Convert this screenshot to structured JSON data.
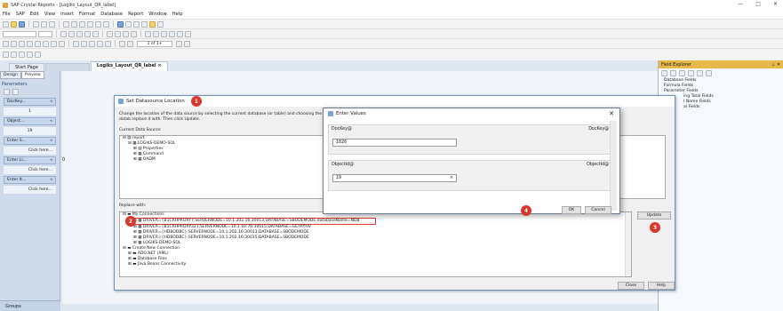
{
  "window": {
    "title": "SAP Crystal Reports - [Logiks_Layout_QR_label]",
    "controls": [
      "—",
      "□",
      "✕"
    ]
  },
  "menu": [
    "File",
    "SAP",
    "Edit",
    "View",
    "Insert",
    "Format",
    "Database",
    "Report",
    "Window",
    "Help"
  ],
  "toolbar": {
    "page_indicator": "1 of 1+"
  },
  "tabs": [
    "Start Page",
    "Logiks_Layout_QR_label"
  ],
  "left_panel": {
    "tabs": [
      "Design",
      "Preview"
    ],
    "title": "Parameters",
    "items": [
      {
        "label": "DocKey...",
        "value": "1"
      },
      {
        "label": "Object...",
        "value": "19"
      },
      {
        "label": "Enter S...",
        "value": "Click here..."
      },
      {
        "label": "Enter Li...",
        "value": "Click here..."
      },
      {
        "label": "Enter It...",
        "value": "Click here..."
      }
    ],
    "canvas_value": "0",
    "groups": "Groups"
  },
  "field_explorer": {
    "title": "Field Explorer",
    "items": [
      "Database Fields",
      "Formula Fields",
      "Parameter Fields",
      "ing Total Fields",
      "l Name Fields",
      "al Fields"
    ]
  },
  "datasource_dialog": {
    "title": "Set Datasource Location",
    "badge": "1",
    "description": "Change the location of the data source by selecting the current database (or table) and choosing the datab replace it with.  Then click Update.",
    "current_label": "Current Data Source:",
    "current_tree": [
      "report",
      "LOGIKS-DEMO-SQL",
      "Properties",
      "Command",
      "OADM"
    ],
    "replace_label": "Replace with:",
    "replace_tree": [
      "My Connections",
      "DRIVER={B1CRHPROXY};SERVERNODE=10.1.202.16:30013;DATABASE=SBODEMODE;databaseName=NDB",
      "DRIVER={B1CRHPROXY32};SERVERNODE=10.1.10.76:30015;DATABASE=GETRYHV",
      "DRIVER={HDBODBC};SERVERNODE=10.1.202.16:30013;DATABASE=SBODEMODE",
      "DRIVER={HDBODBC};SERVERNODE=10.1.202.16:30015;DATABASE=SBODEMODE",
      "LOGIKS-DEMO-SQL",
      "Create New Connection",
      "ADO.NET (XML)",
      "Database Files",
      "Java Beans Connectivity"
    ],
    "badge2": "2",
    "update_label": "Update",
    "badge3": "3",
    "close_label": "Close",
    "help_label": "Help"
  },
  "enter_values": {
    "title": "Enter Values",
    "fields": [
      {
        "label": "DocKey@",
        "right": "DocKey@",
        "value": "1826"
      },
      {
        "label": "ObjectId@",
        "right": "ObjectId@",
        "value": "19"
      }
    ],
    "badge": "4",
    "ok_label": "OK",
    "cancel_label": "Cancel"
  },
  "colors": {
    "badge": "#d9372b",
    "accent": "#4a76b0",
    "field_header": "#e8b84a"
  }
}
